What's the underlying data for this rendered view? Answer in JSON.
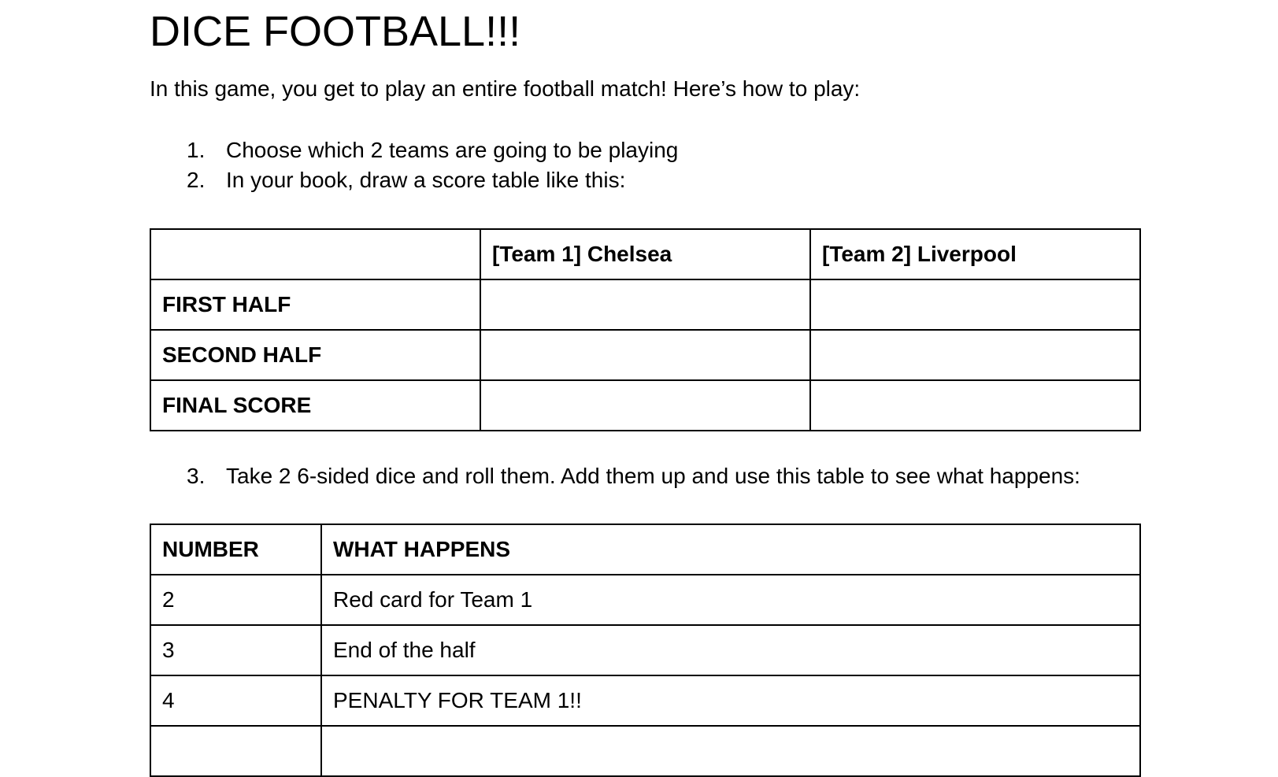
{
  "document": {
    "title": "DICE FOOTBALL!!!",
    "intro": "In this game, you get to play an entire football match! Here’s how to play:",
    "steps": [
      {
        "number": "1.",
        "text": "Choose which 2 teams are going to be playing"
      },
      {
        "number": "2.",
        "text": "In your book, draw a score table like this:"
      },
      {
        "number": "3.",
        "text": "Take 2 6-sided dice and roll them. Add them up and use this table to see what happens:"
      }
    ]
  },
  "score_table": {
    "headers": [
      "",
      "[Team 1] Chelsea",
      "[Team 2] Liverpool"
    ],
    "rows": [
      {
        "label": "FIRST HALF",
        "team1": "",
        "team2": ""
      },
      {
        "label": "SECOND HALF",
        "team1": "",
        "team2": ""
      },
      {
        "label": "FINAL SCORE",
        "team1": "",
        "team2": ""
      }
    ]
  },
  "dice_table": {
    "headers": [
      "NUMBER",
      "WHAT HAPPENS"
    ],
    "rows": [
      {
        "number": "2",
        "outcome": "Red card for Team 1"
      },
      {
        "number": "3",
        "outcome": "End of the half"
      },
      {
        "number": "4",
        "outcome": "PENALTY FOR TEAM 1!!"
      },
      {
        "number": "",
        "outcome": ""
      }
    ]
  }
}
